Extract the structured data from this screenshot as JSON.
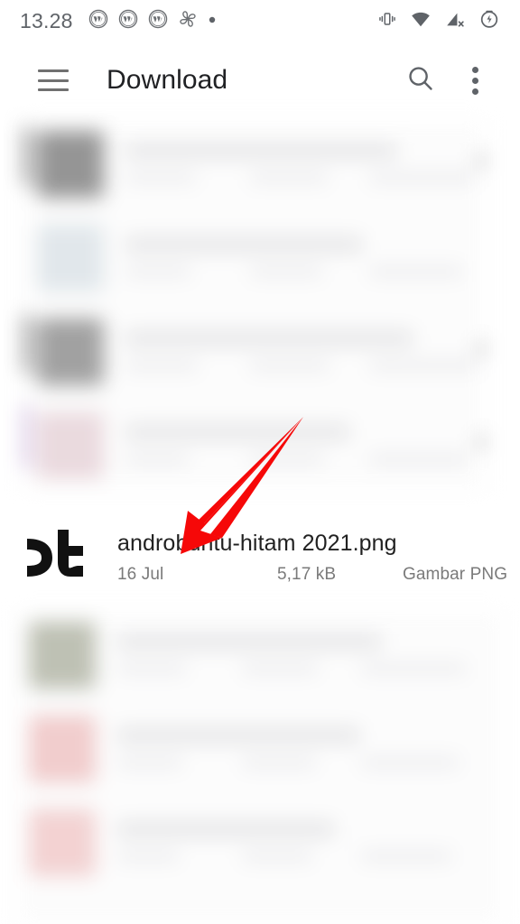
{
  "status_bar": {
    "time": "13.28",
    "left_icons": [
      {
        "name": "wordpress-icon"
      },
      {
        "name": "wordpress-icon"
      },
      {
        "name": "wordpress-icon"
      },
      {
        "name": "google-photos-icon"
      },
      {
        "name": "more-notifications-dot-icon"
      }
    ],
    "right_icons": [
      {
        "name": "vibrate-mode-icon"
      },
      {
        "name": "wifi-icon"
      },
      {
        "name": "mobile-signal-off-icon"
      },
      {
        "name": "battery-saver-icon"
      }
    ],
    "icon_color": "#5f6368"
  },
  "app_bar": {
    "menu_label": "Menu",
    "title": "Download",
    "search_label": "Telusuri",
    "overflow_label": "Opsi lainnya",
    "title_color": "#202124"
  },
  "file_row": {
    "name": "androbuntu-hitam 2021.png",
    "date": "16 Jul",
    "size": "5,17 kB",
    "type": "Gambar PNG",
    "thumbnail_name": "png-image-thumbnail",
    "name_color": "#212121",
    "meta_color": "#7a7a7a"
  },
  "annotation": {
    "arrow_name": "red-arrow-annotation",
    "arrow_color": "#f60808",
    "points_to": "androbuntu-hitam 2021.png"
  },
  "blurred_lists": {
    "top": {
      "label": "blurred-file-list-above",
      "rows": [
        {
          "thumb_color": "#8d8d8d",
          "title_w": 300,
          "m1_w": 78,
          "m2_w": 86,
          "m3_w": 118,
          "edge": true,
          "edge_right": true
        },
        {
          "thumb_color": "#dfe6ea",
          "title_w": 262,
          "m1_w": 72,
          "m2_w": 80,
          "m3_w": 104,
          "edge": false,
          "edge_right": false
        },
        {
          "thumb_color": "#9a9a9a",
          "title_w": 318,
          "m1_w": 80,
          "m2_w": 88,
          "m3_w": 122,
          "edge": true,
          "edge_right": true
        },
        {
          "thumb_color": "#e9d7dc",
          "title_w": 248,
          "m1_w": 70,
          "m2_w": 82,
          "m3_w": 110,
          "edge": true,
          "edge_right": true
        }
      ]
    },
    "bottom": {
      "label": "blurred-file-list-below",
      "rows": [
        {
          "thumb_color": "#b9bcae",
          "title_w": 292,
          "m1_w": 76,
          "m2_w": 84,
          "m3_w": 116,
          "edge": false,
          "edge_right": false
        },
        {
          "thumb_color": "#f0c9c9",
          "title_w": 268,
          "m1_w": 72,
          "m2_w": 82,
          "m3_w": 108,
          "edge": false,
          "edge_right": false
        },
        {
          "thumb_color": "#f2cfcf",
          "title_w": 240,
          "m1_w": 68,
          "m2_w": 78,
          "m3_w": 100,
          "edge": false,
          "edge_right": false
        }
      ]
    }
  }
}
